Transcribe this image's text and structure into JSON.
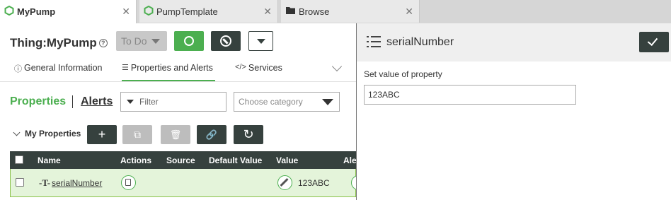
{
  "tabs": [
    {
      "label": "MyPump",
      "icon": "thing-hex-icon",
      "active": true
    },
    {
      "label": "PumpTemplate",
      "icon": "template-hex-icon",
      "active": false
    },
    {
      "label": "Browse",
      "icon": "folder-icon",
      "active": false
    }
  ],
  "close_glyph": "✕",
  "header": {
    "title": "Thing:MyPump",
    "help_glyph": "?",
    "state_label": "To Do"
  },
  "subtabs": [
    {
      "label": "General Information",
      "icon_glyph": "ⓘ"
    },
    {
      "label": "Properties and Alerts",
      "icon_glyph": "☰"
    },
    {
      "label": "Services",
      "icon_glyph": "</>"
    }
  ],
  "section": {
    "properties_label": "Properties",
    "alerts_label": "Alerts",
    "filter_placeholder": "Filter",
    "category_placeholder": "Choose category",
    "group_label": "My Properties"
  },
  "toolbar_glyphs": {
    "add": "+",
    "copy": "⧉",
    "delete": "🗑",
    "link": "🔗",
    "refresh": "↻"
  },
  "table": {
    "columns": [
      "Name",
      "Actions",
      "Source",
      "Default Value",
      "Value",
      "Ale"
    ],
    "rows": [
      {
        "type_glyph": "-T-",
        "name": "serialNumber",
        "value": "123ABC"
      }
    ]
  },
  "panel": {
    "title": "serialNumber",
    "set_label": "Set value of property",
    "input_value": "123ABC"
  },
  "colors": {
    "accent": "#4caf50",
    "dark": "#36413e"
  }
}
